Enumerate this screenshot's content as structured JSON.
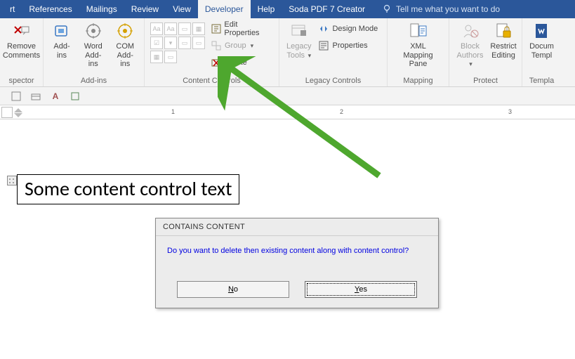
{
  "tabs": {
    "t1": "rt",
    "t2": "References",
    "t3": "Mailings",
    "t4": "Review",
    "t5": "View",
    "t6": "Developer",
    "t7": "Help",
    "t8": "Soda PDF 7 Creator"
  },
  "tell_me": "Tell me what you want to do",
  "ribbon": {
    "remove_comments": "Remove\nComments",
    "spector_label": "spector",
    "addins": "Add-\nins",
    "word_addins": "Word\nAdd-ins",
    "com_addins": "COM\nAdd-ins",
    "addins_label": "Add-ins",
    "edit_props": "Edit Properties",
    "group": "Group",
    "delete": "Delete",
    "cc_label": "Content Controls",
    "legacy_tools": "Legacy\nTools",
    "design_mode": "Design Mode",
    "properties": "Properties",
    "legacy_label": "Legacy Controls",
    "xml_pane": "XML Mapping\nPane",
    "mapping_label": "Mapping",
    "block_authors": "Block\nAuthors",
    "restrict": "Restrict\nEditing",
    "protect_label": "Protect",
    "doc_templ": "Docum\nTempl",
    "templ_label": "Templa"
  },
  "ruler": {
    "n1": "1",
    "n2": "2",
    "n3": "3"
  },
  "doc": {
    "cc_text": "Some content control text"
  },
  "dialog": {
    "title": "CONTAINS CONTENT",
    "body": "Do you want to delete then existing content along with content control?",
    "no": "No",
    "yes": "Yes"
  },
  "sec": {
    "a_label": "A"
  }
}
